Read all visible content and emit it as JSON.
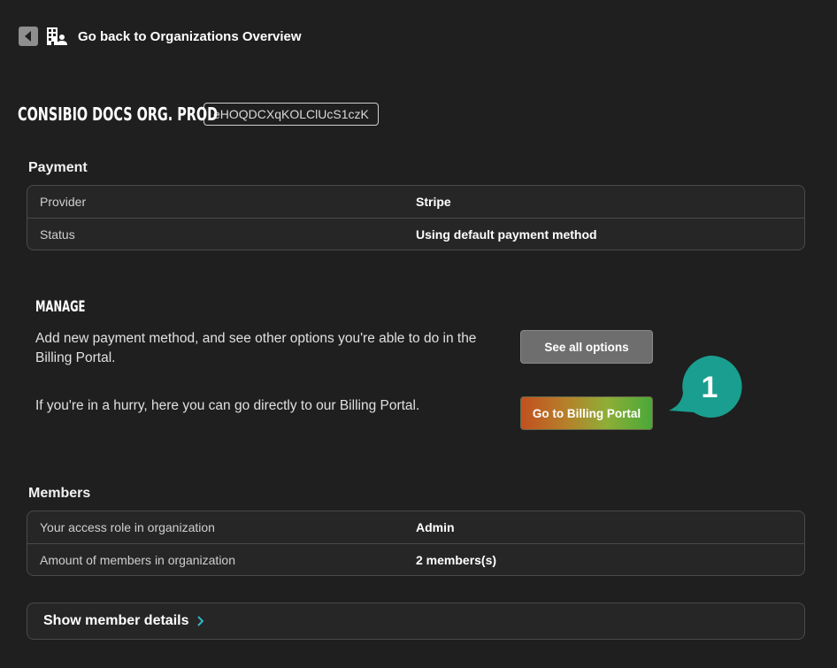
{
  "nav": {
    "back_label": "Go back to Organizations Overview",
    "back_icon": "caret-left-icon",
    "org_icon": "buildings-people-icon"
  },
  "organization": {
    "name": "CONSIBIO DOCS ORG. PROD",
    "id": "eHOQDCXqKOLClUcS1czK"
  },
  "payment": {
    "heading": "Payment",
    "rows": [
      {
        "key": "Provider",
        "value": "Stripe"
      },
      {
        "key": "Status",
        "value": "Using default payment method"
      }
    ]
  },
  "manage": {
    "heading": "MANAGE",
    "options_text": "Add new payment method, and see other options you're able to do in the Billing Portal.",
    "options_button": "See all options",
    "portal_text": "If you're in a hurry, here you can go directly to our Billing Portal.",
    "portal_button": "Go to Billing Portal",
    "callout_number": "1"
  },
  "members": {
    "heading": "Members",
    "rows": [
      {
        "key": "Your access role in organization",
        "value": "Admin"
      },
      {
        "key": "Amount of members in organization",
        "value": "2 members(s)"
      }
    ],
    "details_label": "Show member details"
  },
  "colors": {
    "background": "#1f1f1f",
    "callout": "#1a9e8f",
    "chevron": "#2fb8c9"
  }
}
